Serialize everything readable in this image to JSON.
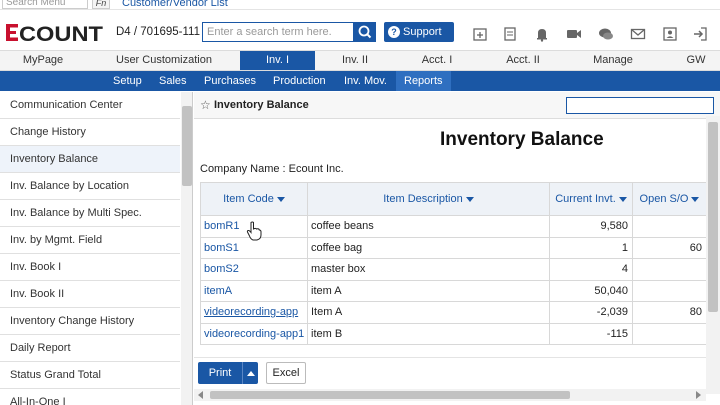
{
  "topbar": {
    "search_menu_placeholder": "Search Menu",
    "fn_label": "Fn",
    "customer_vendor_list": "Customer/Vendor List"
  },
  "header": {
    "logo_text": "ECOUNT",
    "company_code": "D4 / 701695-111",
    "search_placeholder": "Enter a search term here.",
    "support_label": "Support",
    "brand_color": "#1a57a5",
    "logo_color": "#c8102e",
    "icons": [
      "new-window-icon",
      "document-icon",
      "bell-icon",
      "video-icon",
      "chat-icon",
      "mail-icon",
      "user-icon",
      "logout-icon"
    ]
  },
  "main_nav": {
    "items": [
      "MyPage",
      "User Customization",
      "Inv. I",
      "Inv. II",
      "Acct. I",
      "Acct. II",
      "Manage",
      "GW"
    ],
    "active": "Inv. I"
  },
  "sub_nav": {
    "items": [
      "Setup",
      "Sales",
      "Purchases",
      "Production",
      "Inv. Mov.",
      "Reports"
    ],
    "active": "Reports"
  },
  "sidebar": {
    "items": [
      "Communication Center",
      "Change History",
      "Inventory Balance",
      "Inv. Balance by Location",
      "Inv. Balance by Multi Spec.",
      "Inv. by Mgmt. Field",
      "Inv. Book I",
      "Inv. Book II",
      "Inventory Change History",
      "Daily Report",
      "Status Grand Total",
      "All-In-One I"
    ]
  },
  "content": {
    "tab_title": "Inventory Balance",
    "report_title": "Inventory Balance",
    "company_name": "Company Name : Ecount Inc.",
    "columns": [
      "Item Code",
      "Item Description",
      "Current Invt.",
      "Open S/O"
    ],
    "rows": [
      {
        "code": "bomR1",
        "desc": "coffee beans",
        "current": "9,580",
        "open_so": ""
      },
      {
        "code": "bomS1",
        "desc": "coffee bag",
        "current": "1",
        "open_so": "60"
      },
      {
        "code": "bomS2",
        "desc": "master box",
        "current": "4",
        "open_so": ""
      },
      {
        "code": "itemA",
        "desc": "item A",
        "current": "50,040",
        "open_so": ""
      },
      {
        "code": "videorecording-app",
        "desc": "Item A",
        "current": "-2,039",
        "open_so": "80"
      },
      {
        "code": "videorecording-app1",
        "desc": "item B",
        "current": "-115",
        "open_so": ""
      }
    ]
  },
  "bottom": {
    "print_label": "Print",
    "excel_label": "Excel"
  }
}
